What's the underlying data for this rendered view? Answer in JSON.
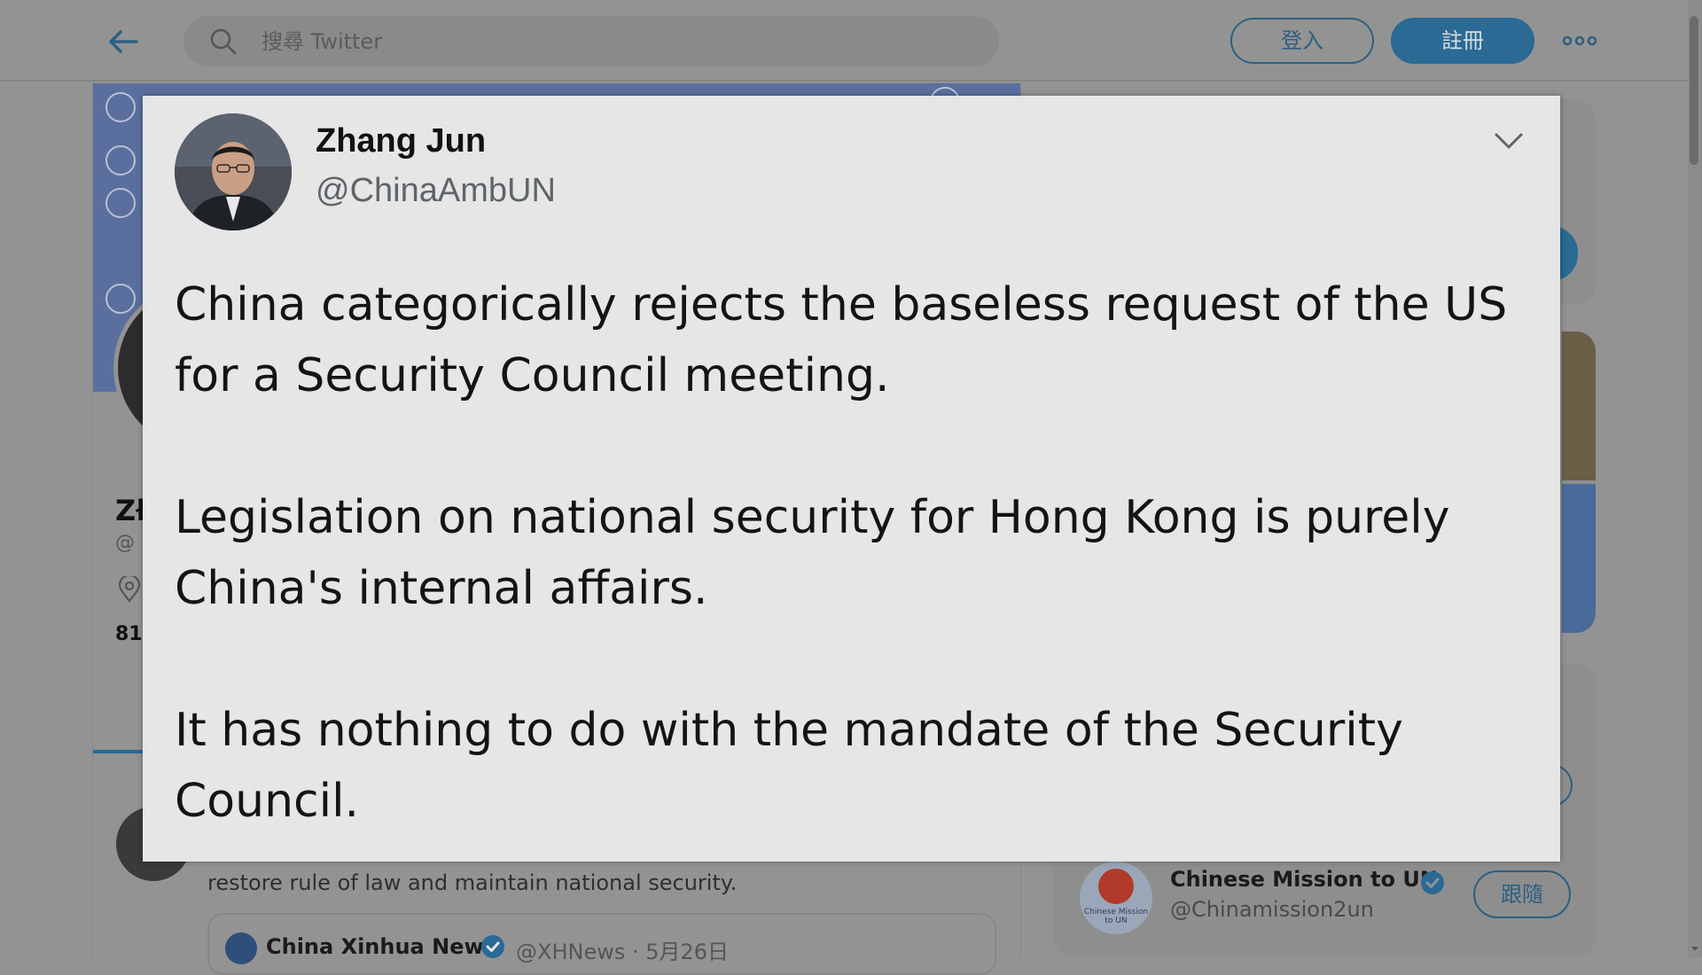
{
  "topbar": {
    "search_placeholder": "搜尋 Twitter",
    "login_label": "登入",
    "signup_label": "註冊"
  },
  "profile": {
    "name_fragment": "Zł",
    "handle_fragment": "@",
    "count_fragment": "81"
  },
  "background_tweet": {
    "text": "restore rule of law and maintain national security.",
    "quote_author": "China Xinhua News",
    "quote_handle_date": "@XHNews · 5月26日"
  },
  "sidebar": {
    "suggested_account": {
      "name": "Chinese Mission to UN",
      "handle": "@Chinamission2un",
      "avatar_caption": "Chinese Mission to UN",
      "follow_label": "跟隨"
    }
  },
  "tweet_card": {
    "author_name": "Zhang Jun",
    "author_handle": "@ChinaAmbUN",
    "paragraphs": [
      "China categorically rejects the baseless request of the US for a Security Council meeting.",
      "Legislation on national security for Hong Kong is purely China's internal affairs.",
      "It has nothing to do with the mandate of the Security Council."
    ]
  },
  "colors": {
    "accent": "#2a6a94",
    "card_background": "#e6e6e6",
    "page_dim": "#939393"
  },
  "icons": [
    "back-arrow-icon",
    "search-icon",
    "more-icon",
    "location-icon",
    "verified-icon",
    "chevron-down-icon"
  ]
}
